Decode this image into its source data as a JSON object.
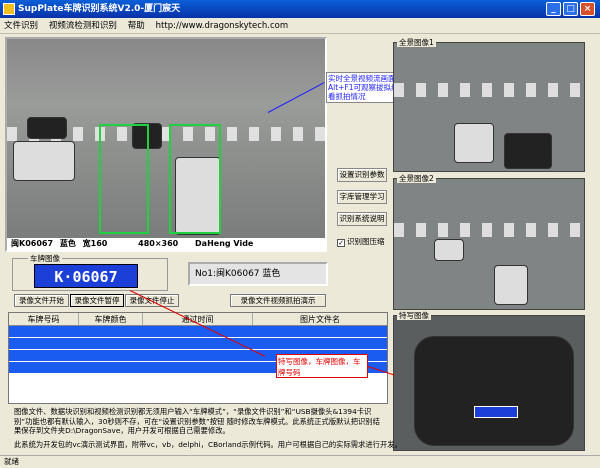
{
  "window": {
    "title": "SupPlate车牌识别系统V2.0-厦门宸天",
    "minimize": "_",
    "maximize": "□",
    "close": "×"
  },
  "menu": {
    "items": [
      "文件识别",
      "视频流检测和识别",
      "帮助",
      "http://www.dragonskytech.com"
    ]
  },
  "main_video": {
    "info_plate": "闽K06067",
    "info_color": "蓝色",
    "info_width": "宽160",
    "info_size": "480×360",
    "info_vendor": "DaHeng Vide",
    "annotation": "实时全景视频流画面，按Alt+F1可观察拔拟线画面，查看抓拍情况"
  },
  "side_buttons": {
    "settings": "设置识别参数",
    "library": "字库管理学习",
    "help": "识别系统说明",
    "compress_label": "识别图压缩",
    "compress_checked": true
  },
  "thumbnails": {
    "pano1": "全景图像1",
    "pano2": "全景图像2",
    "feature": "特写图像"
  },
  "plate_area": {
    "group_label": "车牌图像",
    "plate_text": "K·06067",
    "result_text": "No1:闽K06067 蓝色"
  },
  "buttons": {
    "start": "录像文件开始",
    "pause": "录像文件暂停",
    "stop": "录像文件停止",
    "demo": "录像文件视频抓拍演示"
  },
  "table": {
    "headers": [
      "车牌号码",
      "车牌颜色",
      "通过时间",
      "图片文件名"
    ]
  },
  "callout": "特写图像，车牌图像，车牌号码",
  "description": "图像文件、数据块识别和视频检测识别都无须用户输入“车牌模式”，“录像文件识别”和“USB摄像头&1394卡识别”功能也都有默认输入，30秒则不存，可在“设置识别参数”按钮 随时修改车牌模式。此系统正式版默认把识别结果保存到文件夹D:\\DragonSave，用户开发可根据自己需要修改。",
  "description2": "此系统为开发包的vc演示测试界面，附带vc，vb，delphi，CBorland示例代码。用户可根据自己的实际需求进行开发。",
  "status": "就绪"
}
